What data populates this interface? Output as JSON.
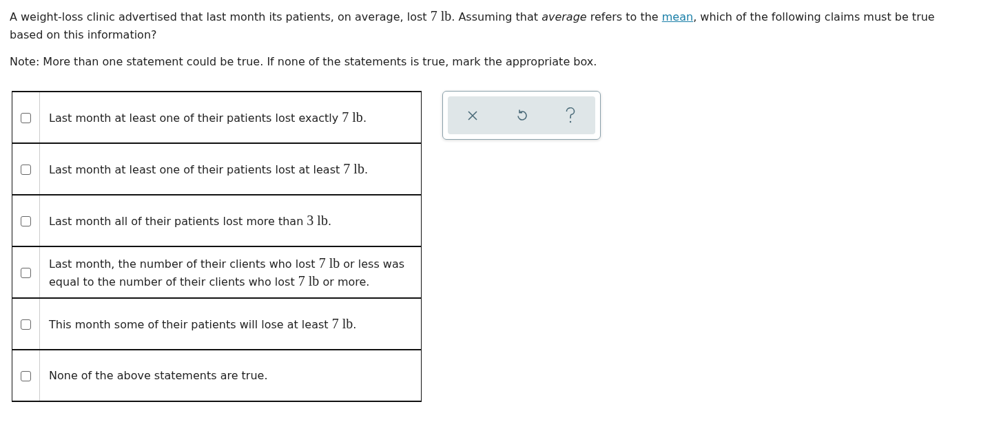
{
  "question": [
    {
      "kind": "text",
      "text": "A weight-loss clinic advertised that last month its patients, on average, lost "
    },
    {
      "kind": "math",
      "text": "7 lb"
    },
    {
      "kind": "text",
      "text": ". Assuming that "
    },
    {
      "kind": "italic",
      "text": "average"
    },
    {
      "kind": "text",
      "text": " refers to the "
    },
    {
      "kind": "link",
      "text": "mean"
    },
    {
      "kind": "text",
      "text": ", which of the following claims must be true based on this information?"
    }
  ],
  "note": "Note: More than one statement could be true. If none of the statements is true, mark the appropriate box.",
  "options": [
    {
      "checked": false,
      "parts": [
        {
          "kind": "text",
          "text": "Last month at least one of their patients lost exactly "
        },
        {
          "kind": "math",
          "text": "7 lb"
        },
        {
          "kind": "text",
          "text": "."
        }
      ]
    },
    {
      "checked": false,
      "parts": [
        {
          "kind": "text",
          "text": "Last month at least one of their patients lost at least "
        },
        {
          "kind": "math",
          "text": "7 lb"
        },
        {
          "kind": "text",
          "text": "."
        }
      ]
    },
    {
      "checked": false,
      "parts": [
        {
          "kind": "text",
          "text": "Last month all of their patients lost more than "
        },
        {
          "kind": "math",
          "text": "3 lb"
        },
        {
          "kind": "text",
          "text": "."
        }
      ]
    },
    {
      "checked": false,
      "parts": [
        {
          "kind": "text",
          "text": "Last month, the number of their clients who lost "
        },
        {
          "kind": "math",
          "text": "7 lb"
        },
        {
          "kind": "text",
          "text": " or less was equal to the number of their clients who lost "
        },
        {
          "kind": "math",
          "text": "7 lb"
        },
        {
          "kind": "text",
          "text": " or more."
        }
      ]
    },
    {
      "checked": false,
      "parts": [
        {
          "kind": "text",
          "text": "This month some of their patients will lose at least "
        },
        {
          "kind": "math",
          "text": "7 lb"
        },
        {
          "kind": "text",
          "text": "."
        }
      ]
    },
    {
      "checked": false,
      "parts": [
        {
          "kind": "text",
          "text": "None of the above statements are true."
        }
      ]
    }
  ]
}
